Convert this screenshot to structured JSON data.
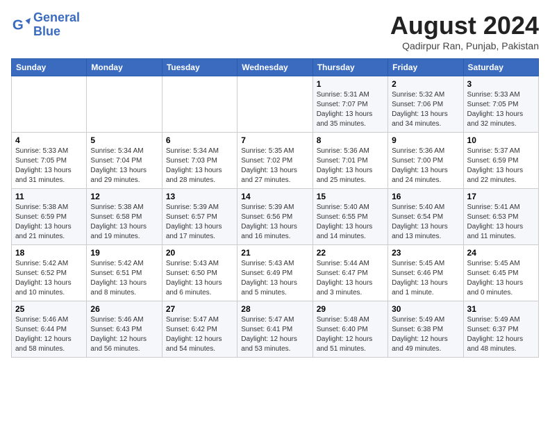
{
  "header": {
    "logo_line1": "General",
    "logo_line2": "Blue",
    "month_year": "August 2024",
    "location": "Qadirpur Ran, Punjab, Pakistan"
  },
  "days_of_week": [
    "Sunday",
    "Monday",
    "Tuesday",
    "Wednesday",
    "Thursday",
    "Friday",
    "Saturday"
  ],
  "weeks": [
    [
      {
        "day": "",
        "info": ""
      },
      {
        "day": "",
        "info": ""
      },
      {
        "day": "",
        "info": ""
      },
      {
        "day": "",
        "info": ""
      },
      {
        "day": "1",
        "info": "Sunrise: 5:31 AM\nSunset: 7:07 PM\nDaylight: 13 hours\nand 35 minutes."
      },
      {
        "day": "2",
        "info": "Sunrise: 5:32 AM\nSunset: 7:06 PM\nDaylight: 13 hours\nand 34 minutes."
      },
      {
        "day": "3",
        "info": "Sunrise: 5:33 AM\nSunset: 7:05 PM\nDaylight: 13 hours\nand 32 minutes."
      }
    ],
    [
      {
        "day": "4",
        "info": "Sunrise: 5:33 AM\nSunset: 7:05 PM\nDaylight: 13 hours\nand 31 minutes."
      },
      {
        "day": "5",
        "info": "Sunrise: 5:34 AM\nSunset: 7:04 PM\nDaylight: 13 hours\nand 29 minutes."
      },
      {
        "day": "6",
        "info": "Sunrise: 5:34 AM\nSunset: 7:03 PM\nDaylight: 13 hours\nand 28 minutes."
      },
      {
        "day": "7",
        "info": "Sunrise: 5:35 AM\nSunset: 7:02 PM\nDaylight: 13 hours\nand 27 minutes."
      },
      {
        "day": "8",
        "info": "Sunrise: 5:36 AM\nSunset: 7:01 PM\nDaylight: 13 hours\nand 25 minutes."
      },
      {
        "day": "9",
        "info": "Sunrise: 5:36 AM\nSunset: 7:00 PM\nDaylight: 13 hours\nand 24 minutes."
      },
      {
        "day": "10",
        "info": "Sunrise: 5:37 AM\nSunset: 6:59 PM\nDaylight: 13 hours\nand 22 minutes."
      }
    ],
    [
      {
        "day": "11",
        "info": "Sunrise: 5:38 AM\nSunset: 6:59 PM\nDaylight: 13 hours\nand 21 minutes."
      },
      {
        "day": "12",
        "info": "Sunrise: 5:38 AM\nSunset: 6:58 PM\nDaylight: 13 hours\nand 19 minutes."
      },
      {
        "day": "13",
        "info": "Sunrise: 5:39 AM\nSunset: 6:57 PM\nDaylight: 13 hours\nand 17 minutes."
      },
      {
        "day": "14",
        "info": "Sunrise: 5:39 AM\nSunset: 6:56 PM\nDaylight: 13 hours\nand 16 minutes."
      },
      {
        "day": "15",
        "info": "Sunrise: 5:40 AM\nSunset: 6:55 PM\nDaylight: 13 hours\nand 14 minutes."
      },
      {
        "day": "16",
        "info": "Sunrise: 5:40 AM\nSunset: 6:54 PM\nDaylight: 13 hours\nand 13 minutes."
      },
      {
        "day": "17",
        "info": "Sunrise: 5:41 AM\nSunset: 6:53 PM\nDaylight: 13 hours\nand 11 minutes."
      }
    ],
    [
      {
        "day": "18",
        "info": "Sunrise: 5:42 AM\nSunset: 6:52 PM\nDaylight: 13 hours\nand 10 minutes."
      },
      {
        "day": "19",
        "info": "Sunrise: 5:42 AM\nSunset: 6:51 PM\nDaylight: 13 hours\nand 8 minutes."
      },
      {
        "day": "20",
        "info": "Sunrise: 5:43 AM\nSunset: 6:50 PM\nDaylight: 13 hours\nand 6 minutes."
      },
      {
        "day": "21",
        "info": "Sunrise: 5:43 AM\nSunset: 6:49 PM\nDaylight: 13 hours\nand 5 minutes."
      },
      {
        "day": "22",
        "info": "Sunrise: 5:44 AM\nSunset: 6:47 PM\nDaylight: 13 hours\nand 3 minutes."
      },
      {
        "day": "23",
        "info": "Sunrise: 5:45 AM\nSunset: 6:46 PM\nDaylight: 13 hours\nand 1 minute."
      },
      {
        "day": "24",
        "info": "Sunrise: 5:45 AM\nSunset: 6:45 PM\nDaylight: 13 hours\nand 0 minutes."
      }
    ],
    [
      {
        "day": "25",
        "info": "Sunrise: 5:46 AM\nSunset: 6:44 PM\nDaylight: 12 hours\nand 58 minutes."
      },
      {
        "day": "26",
        "info": "Sunrise: 5:46 AM\nSunset: 6:43 PM\nDaylight: 12 hours\nand 56 minutes."
      },
      {
        "day": "27",
        "info": "Sunrise: 5:47 AM\nSunset: 6:42 PM\nDaylight: 12 hours\nand 54 minutes."
      },
      {
        "day": "28",
        "info": "Sunrise: 5:47 AM\nSunset: 6:41 PM\nDaylight: 12 hours\nand 53 minutes."
      },
      {
        "day": "29",
        "info": "Sunrise: 5:48 AM\nSunset: 6:40 PM\nDaylight: 12 hours\nand 51 minutes."
      },
      {
        "day": "30",
        "info": "Sunrise: 5:49 AM\nSunset: 6:38 PM\nDaylight: 12 hours\nand 49 minutes."
      },
      {
        "day": "31",
        "info": "Sunrise: 5:49 AM\nSunset: 6:37 PM\nDaylight: 12 hours\nand 48 minutes."
      }
    ]
  ]
}
